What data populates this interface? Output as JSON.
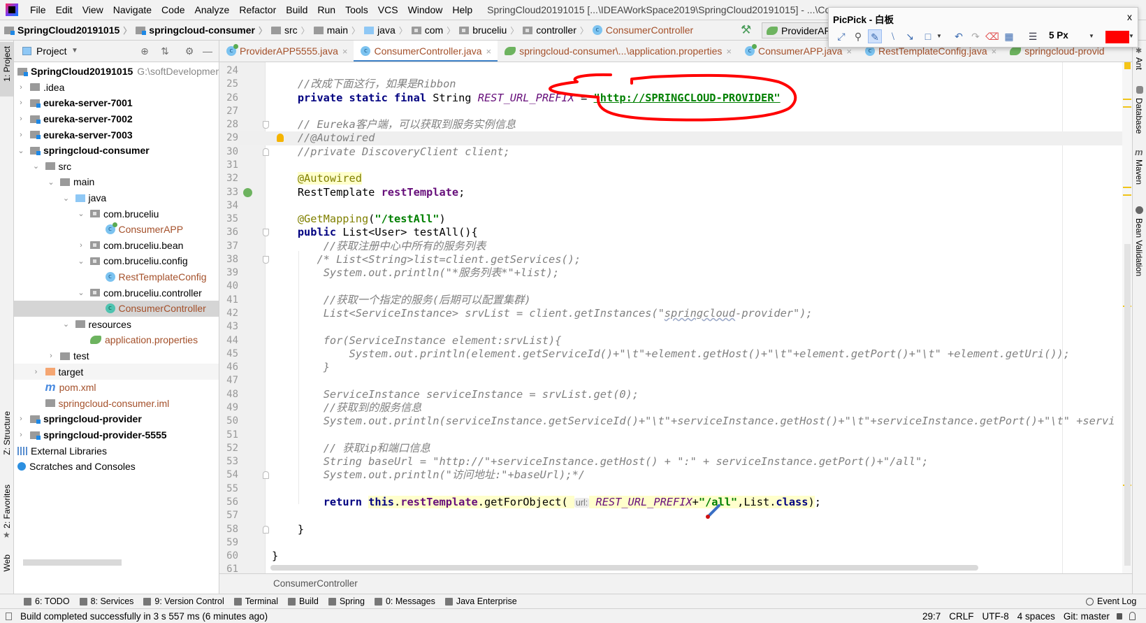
{
  "menubar": {
    "items": [
      "File",
      "Edit",
      "View",
      "Navigate",
      "Code",
      "Analyze",
      "Refactor",
      "Build",
      "Run",
      "Tools",
      "VCS",
      "Window",
      "Help"
    ],
    "window_title": "SpringCloud20191015 [...\\IDEAWorkSpace2019\\SpringCloud20191015] - ...\\Co"
  },
  "navbar": {
    "crumbs": [
      {
        "label": "SpringCloud20191015",
        "icon": "module-folder-icon"
      },
      {
        "label": "springcloud-consumer",
        "icon": "module-folder-icon"
      },
      {
        "label": "src",
        "icon": "folder-icon"
      },
      {
        "label": "main",
        "icon": "folder-icon"
      },
      {
        "label": "java",
        "icon": "source-folder-icon"
      },
      {
        "label": "com",
        "icon": "package-icon"
      },
      {
        "label": "bruceliu",
        "icon": "package-icon"
      },
      {
        "label": "controller",
        "icon": "package-icon"
      },
      {
        "label": "ConsumerController",
        "icon": "class-icon"
      }
    ],
    "run_config": "ProviderAP"
  },
  "picpick": {
    "title": "PicPick - 白板",
    "close": "x",
    "pen_size": "5 Px",
    "pen_color": "#ff0000"
  },
  "left_strip": {
    "project": "1: Project",
    "structure": "Z: Structure",
    "favorites": "2: Favorites",
    "web": "Web"
  },
  "right_strip": {
    "ant": "Ant",
    "database": "Database",
    "maven": "Maven",
    "bean_validation": "Bean Validation"
  },
  "project": {
    "title": "Project",
    "tree": [
      {
        "label": "SpringCloud20191015",
        "path": "G:\\softDevelopment",
        "level": 0,
        "icon": "module",
        "bold": true
      },
      {
        "label": ".idea",
        "level": 1,
        "icon": "folder",
        "chevron": "right"
      },
      {
        "label": "eureka-server-7001",
        "level": 1,
        "icon": "module",
        "bold": true,
        "chevron": "right"
      },
      {
        "label": "eureka-server-7002",
        "level": 1,
        "icon": "module",
        "bold": true,
        "chevron": "right"
      },
      {
        "label": "eureka-server-7003",
        "level": 1,
        "icon": "module",
        "bold": true,
        "chevron": "right"
      },
      {
        "label": "springcloud-consumer",
        "level": 1,
        "icon": "module",
        "bold": true,
        "chevron": "down"
      },
      {
        "label": "src",
        "level": 2,
        "icon": "folder",
        "chevron": "down"
      },
      {
        "label": "main",
        "level": 3,
        "icon": "folder",
        "chevron": "down"
      },
      {
        "label": "java",
        "level": 4,
        "icon": "source",
        "chevron": "down"
      },
      {
        "label": "com.bruceliu",
        "level": 5,
        "icon": "package",
        "chevron": "down"
      },
      {
        "label": "ConsumerAPP",
        "level": 6,
        "icon": "spring-class",
        "modified": true
      },
      {
        "label": "com.bruceliu.bean",
        "level": 5,
        "icon": "package",
        "chevron": "right"
      },
      {
        "label": "com.bruceliu.config",
        "level": 5,
        "icon": "package",
        "chevron": "down"
      },
      {
        "label": "RestTemplateConfig",
        "level": 6,
        "icon": "class",
        "modified": true
      },
      {
        "label": "com.bruceliu.controller",
        "level": 5,
        "icon": "package",
        "chevron": "down"
      },
      {
        "label": "ConsumerController",
        "level": 6,
        "icon": "teal-class",
        "modified": true,
        "selected": true
      },
      {
        "label": "resources",
        "level": 4,
        "icon": "resources",
        "chevron": "down"
      },
      {
        "label": "application.properties",
        "level": 5,
        "icon": "spring-props",
        "modified": true
      },
      {
        "label": "test",
        "level": 3,
        "icon": "folder",
        "chevron": "right"
      },
      {
        "label": "target",
        "level": 2,
        "icon": "excluded",
        "chevron": "right",
        "shaded": true
      },
      {
        "label": "pom.xml",
        "level": 2,
        "icon": "maven",
        "modified": true
      },
      {
        "label": "springcloud-consumer.iml",
        "level": 2,
        "icon": "iml",
        "modified": true
      },
      {
        "label": "springcloud-provider",
        "level": 1,
        "icon": "module",
        "bold": true,
        "chevron": "right"
      },
      {
        "label": "springcloud-provider-5555",
        "level": 1,
        "icon": "module",
        "bold": true,
        "chevron": "right"
      },
      {
        "label": "External Libraries",
        "level": 0,
        "icon": "libraries"
      },
      {
        "label": "Scratches and Consoles",
        "level": 0,
        "icon": "scratches"
      }
    ]
  },
  "tabs": [
    {
      "label": "ProviderAPP5555.java",
      "icon": "spring-class",
      "active": false
    },
    {
      "label": "ConsumerController.java",
      "icon": "class",
      "active": true
    },
    {
      "label": "springcloud-consumer\\...\\application.properties",
      "icon": "spring-props",
      "active": false
    },
    {
      "label": "ConsumerAPP.java",
      "icon": "spring-class",
      "active": false
    },
    {
      "label": "RestTemplateConfig.java",
      "icon": "class",
      "active": false
    },
    {
      "label": "springcloud-provid",
      "icon": "spring-props",
      "active": false,
      "truncated": true
    }
  ],
  "editor": {
    "current_line": 29,
    "lines": [
      {
        "num": "24",
        "tokens": []
      },
      {
        "num": "25",
        "tokens": [
          [
            "    ",
            ""
          ],
          [
            "//改成下面这行，如果是Ribbon",
            "cm"
          ]
        ]
      },
      {
        "num": "26",
        "tokens": [
          [
            "    ",
            ""
          ],
          [
            "private static final",
            "kw"
          ],
          [
            " String ",
            ""
          ],
          [
            "REST_URL_PREFIX",
            "cst"
          ],
          [
            " = ",
            ""
          ],
          [
            "\"http://SPRINGCLOUD-PROVIDER\"",
            "str ul"
          ]
        ]
      },
      {
        "num": "27",
        "tokens": []
      },
      {
        "num": "28",
        "tokens": [
          [
            "    ",
            ""
          ],
          [
            "// Eureka客户端，可以获取到服务实例信息",
            "cm"
          ]
        ],
        "fold": "start"
      },
      {
        "num": "29",
        "tokens": [
          [
            "    ",
            ""
          ],
          [
            "//@Autowired",
            "cm"
          ]
        ],
        "bulb": true
      },
      {
        "num": "30",
        "tokens": [
          [
            "    ",
            ""
          ],
          [
            "//private DiscoveryClient client;",
            "cm"
          ]
        ],
        "fold": "end"
      },
      {
        "num": "31",
        "tokens": []
      },
      {
        "num": "32",
        "tokens": [
          [
            "    ",
            ""
          ],
          [
            "@Autowired",
            "an hl"
          ]
        ]
      },
      {
        "num": "33",
        "tokens": [
          [
            "    ",
            ""
          ],
          [
            "RestTemplate ",
            ""
          ],
          [
            "restTemplate",
            "fld"
          ],
          [
            ";",
            ""
          ]
        ],
        "bean": true
      },
      {
        "num": "34",
        "tokens": []
      },
      {
        "num": "35",
        "tokens": [
          [
            "    ",
            ""
          ],
          [
            "@GetMapping",
            "an"
          ],
          [
            "(",
            ""
          ],
          [
            "\"/testAll\"",
            "str"
          ],
          [
            ")",
            ""
          ]
        ]
      },
      {
        "num": "36",
        "tokens": [
          [
            "    ",
            ""
          ],
          [
            "public",
            "kw"
          ],
          [
            " List<User> testAll(){",
            ""
          ]
        ],
        "fold": "start"
      },
      {
        "num": "37",
        "tokens": [
          [
            "        ",
            ""
          ],
          [
            "//获取注册中心中所有的服务列表",
            "cm"
          ]
        ]
      },
      {
        "num": "38",
        "tokens": [
          [
            "       ",
            ""
          ],
          [
            "/* List<String>list=client.getServices();",
            "cm"
          ]
        ],
        "fold": "start"
      },
      {
        "num": "39",
        "tokens": [
          [
            "        ",
            ""
          ],
          [
            "System.out.println(\"*服务列表*\"+list);",
            "cm"
          ]
        ]
      },
      {
        "num": "40",
        "tokens": []
      },
      {
        "num": "41",
        "tokens": [
          [
            "        ",
            ""
          ],
          [
            "//获取一个指定的服务(后期可以配置集群)",
            "cm"
          ]
        ]
      },
      {
        "num": "42",
        "tokens": [
          [
            "        ",
            ""
          ],
          [
            "List<ServiceInstance> srvList = client.getInstances(\"",
            "cm"
          ],
          [
            "springcloud",
            "cm wavy"
          ],
          [
            "-provider\");",
            "cm"
          ]
        ]
      },
      {
        "num": "43",
        "tokens": []
      },
      {
        "num": "44",
        "tokens": [
          [
            "        ",
            ""
          ],
          [
            "for(ServiceInstance element:srvList){",
            "cm"
          ]
        ]
      },
      {
        "num": "45",
        "tokens": [
          [
            "            ",
            ""
          ],
          [
            "System.out.println(element.getServiceId()+\"\\t\"+element.getHost()+\"\\t\"+element.getPort()+\"\\t\" +element.getUri());",
            "cm"
          ]
        ]
      },
      {
        "num": "46",
        "tokens": [
          [
            "        ",
            ""
          ],
          [
            "}",
            "cm"
          ]
        ]
      },
      {
        "num": "47",
        "tokens": []
      },
      {
        "num": "48",
        "tokens": [
          [
            "        ",
            ""
          ],
          [
            "ServiceInstance serviceInstance = srvList.get(0);",
            "cm"
          ]
        ]
      },
      {
        "num": "49",
        "tokens": [
          [
            "        ",
            ""
          ],
          [
            "//获取到的服务信息",
            "cm"
          ]
        ]
      },
      {
        "num": "50",
        "tokens": [
          [
            "        ",
            ""
          ],
          [
            "System.out.println(serviceInstance.getServiceId()+\"\\t\"+serviceInstance.getHost()+\"\\t\"+serviceInstance.getPort()+\"\\t\" +servi",
            "cm"
          ]
        ]
      },
      {
        "num": "51",
        "tokens": []
      },
      {
        "num": "52",
        "tokens": [
          [
            "        ",
            ""
          ],
          [
            "// 获取ip和端口信息",
            "cm"
          ]
        ]
      },
      {
        "num": "53",
        "tokens": [
          [
            "        ",
            ""
          ],
          [
            "String baseUrl = \"http://\"+serviceInstance.getHost() + \":\" + serviceInstance.getPort()+\"/all\";",
            "cm"
          ]
        ]
      },
      {
        "num": "54",
        "tokens": [
          [
            "        ",
            ""
          ],
          [
            "System.out.println(\"访问地址:\"+baseUrl);*/",
            "cm"
          ]
        ],
        "fold": "end"
      },
      {
        "num": "55",
        "tokens": []
      },
      {
        "num": "56",
        "tokens": [
          [
            "        ",
            ""
          ],
          [
            "return",
            "kw"
          ],
          [
            " ",
            ""
          ],
          [
            "this",
            "kw hl"
          ],
          [
            ".",
            "hl"
          ],
          [
            "restTemplate",
            "fld hl"
          ],
          [
            ".getForObject( ",
            "hl"
          ],
          [
            "url:",
            "hint"
          ],
          [
            " ",
            "hl"
          ],
          [
            "REST_URL_PREFIX",
            "cst hl"
          ],
          [
            "+",
            "hl"
          ],
          [
            "\"/all\"",
            "str hl"
          ],
          [
            ",List.",
            "hl"
          ],
          [
            "class",
            "kw hl"
          ],
          [
            ")",
            "hl"
          ],
          [
            ";",
            ""
          ]
        ]
      },
      {
        "num": "57",
        "tokens": []
      },
      {
        "num": "58",
        "tokens": [
          [
            "    ",
            ""
          ],
          [
            "}",
            ""
          ]
        ],
        "fold": "end"
      },
      {
        "num": "59",
        "tokens": []
      },
      {
        "num": "60",
        "tokens": [
          [
            "}",
            ""
          ]
        ]
      },
      {
        "num": "61",
        "tokens": []
      }
    ],
    "breadcrumb": "ConsumerController"
  },
  "toolwindows": {
    "left": [
      "6: TODO",
      "8: Services",
      "9: Version Control",
      "Terminal",
      "Build",
      "Spring",
      "0: Messages",
      "Java Enterprise"
    ],
    "event_log": "Event Log"
  },
  "status": {
    "message": "Build completed successfully in 3 s 557 ms (6 minutes ago)",
    "position": "29:7",
    "line_sep": "CRLF",
    "encoding": "UTF-8",
    "indent": "4 spaces",
    "vcs": "Git: master"
  },
  "colors": {
    "annotation_stroke": "#ff0000",
    "tab_accent": "#4083c9",
    "modified_file": "#a4502a"
  }
}
